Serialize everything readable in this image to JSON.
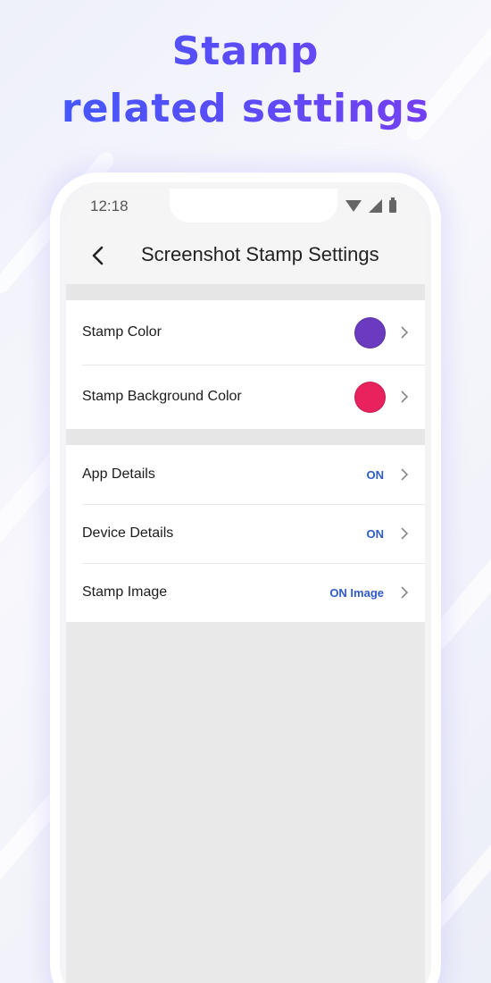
{
  "promo": {
    "line1": "Stamp",
    "line2": "related settings"
  },
  "status_bar": {
    "time": "12:18",
    "icons": [
      "wifi-icon",
      "signal-icon",
      "battery-icon"
    ]
  },
  "app_bar": {
    "title": "Screenshot Stamp Settings",
    "back_icon": "back-arrow-icon"
  },
  "colors": {
    "stamp_color": "#6a3bbf",
    "stamp_background_color": "#e8225c",
    "value_text": "#2f5bc8",
    "promo_gradient": [
      "#3d5bff",
      "#7b3cf0"
    ]
  },
  "settings": {
    "color_group": [
      {
        "label": "Stamp Color",
        "swatch": "#6a3bbf"
      },
      {
        "label": "Stamp Background Color",
        "swatch": "#e8225c"
      }
    ],
    "toggle_group": [
      {
        "label": "App Details",
        "value": "ON"
      },
      {
        "label": "Device Details",
        "value": "ON"
      },
      {
        "label": "Stamp Image",
        "value": "ON Image"
      }
    ]
  }
}
